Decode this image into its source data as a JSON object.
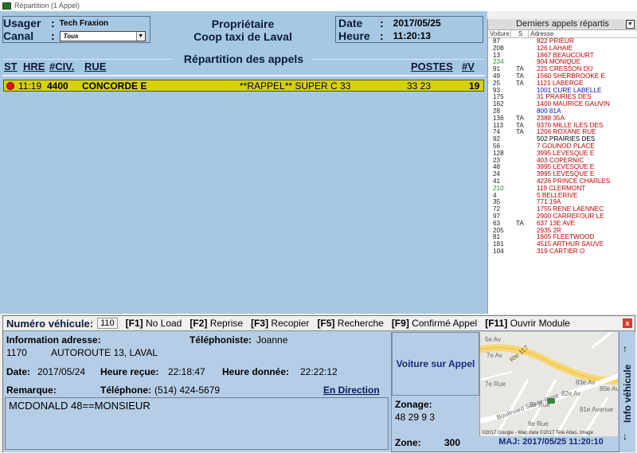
{
  "window": {
    "title": "Répartition (1 Appel)"
  },
  "header": {
    "usager_label": "Usager",
    "usager_value": "Tech Fraxion",
    "canal_label": "Canal",
    "canal_value": "Tous",
    "owner_line1": "Propriétaire",
    "owner_line2": "Coop taxi de Laval",
    "date_label": "Date",
    "date_value": "2017/05/25",
    "heure_label": "Heure",
    "heure_value": "11:20:13"
  },
  "dispatch": {
    "title": "Répartition des appels",
    "columns": {
      "st": "ST",
      "hre": "HRE",
      "civ": "#CIV.",
      "rue": "RUE",
      "postes": "POSTES",
      "v": "#V"
    },
    "call": {
      "time": "11:19",
      "civ": "4400",
      "street": "CONCORDE E",
      "note": "**RAPPEL** SUPER C 33",
      "postes": "33 23",
      "v": "19",
      "status_color": "#e41010"
    }
  },
  "recent": {
    "title": "Derniers appels répartis",
    "headers": {
      "voiture": "Voiture",
      "s": "S",
      "adresse": "Adresse"
    },
    "rows": [
      {
        "v": "87",
        "s": "",
        "a": "822 PRIEUR",
        "c": "#c00000"
      },
      {
        "v": "208",
        "s": "",
        "a": "126 LAHAIE",
        "c": "#c00000"
      },
      {
        "v": "13",
        "s": "",
        "a": "1867 BEAUCOURT",
        "c": "#c00000"
      },
      {
        "v": "234",
        "s": "",
        "a": "904 MONIQUE",
        "c": "#c00000",
        "vc": "#1a9a1a"
      },
      {
        "v": "91",
        "s": "TA",
        "a": "225 CRESSON DU",
        "c": "#c00000"
      },
      {
        "v": "49",
        "s": "TA",
        "a": "1560 SHERBROOKE E",
        "c": "#c00000"
      },
      {
        "v": "25",
        "s": "TA",
        "a": "1121 LABERGE",
        "c": "#c00000"
      },
      {
        "v": "93",
        "s": "",
        "a": "1001 CURE LABELLE",
        "c": "#1010d0"
      },
      {
        "v": "175",
        "s": "",
        "a": "31 PRAIRIES DES",
        "c": "#c00000"
      },
      {
        "v": "162",
        "s": "",
        "a": "1400 MAURICE GAUVIN",
        "c": "#c00000"
      },
      {
        "v": "28",
        "s": "",
        "a": "800 81A",
        "c": "#1010d0"
      },
      {
        "v": "136",
        "s": "TA",
        "a": "2388 35A",
        "c": "#c00000"
      },
      {
        "v": "113",
        "s": "TA",
        "a": "9370 MILLE ILES DES",
        "c": "#c00000"
      },
      {
        "v": "74",
        "s": "TA",
        "a": "1206 ROXANE RUE",
        "c": "#c00000"
      },
      {
        "v": "92",
        "s": "",
        "a": "502 PRAIRIES DES",
        "c": "#000000"
      },
      {
        "v": "56",
        "s": "",
        "a": "7 GOUNOD PLACE",
        "c": "#c00000"
      },
      {
        "v": "128",
        "s": "",
        "a": "3995 LEVESQUE E",
        "c": "#c00000"
      },
      {
        "v": "23",
        "s": "",
        "a": "403 COPERNIC",
        "c": "#c00000"
      },
      {
        "v": "48",
        "s": "",
        "a": "3995 LEVESQUE E",
        "c": "#c00000"
      },
      {
        "v": "24",
        "s": "",
        "a": "3995 LEVESQUE E",
        "c": "#c00000"
      },
      {
        "v": "41",
        "s": "",
        "a": "4226 PRINCE CHARLES",
        "c": "#c00000"
      },
      {
        "v": "210",
        "s": "",
        "a": "119 CLERMONT",
        "c": "#c00000",
        "vc": "#1a9a1a"
      },
      {
        "v": "4",
        "s": "",
        "a": "5 BELLERIVE",
        "c": "#c00000"
      },
      {
        "v": "35",
        "s": "",
        "a": "771 19A",
        "c": "#c00000"
      },
      {
        "v": "72",
        "s": "",
        "a": "1755 RENE LAENNEC",
        "c": "#c00000"
      },
      {
        "v": "97",
        "s": "",
        "a": "2900 CARREFOUR LE",
        "c": "#c00000"
      },
      {
        "v": "63",
        "s": "TA",
        "a": "637 13E AVE",
        "c": "#c00000"
      },
      {
        "v": "205",
        "s": "",
        "a": "2935 2R",
        "c": "#c00000"
      },
      {
        "v": "81",
        "s": "",
        "a": "1605 FLEETWOOD",
        "c": "#c00000"
      },
      {
        "v": "181",
        "s": "",
        "a": "4515 ARTHUR SAUVE",
        "c": "#c00000"
      },
      {
        "v": "104",
        "s": "",
        "a": "319 CARTIER O",
        "c": "#c00000"
      }
    ]
  },
  "bottom": {
    "vehicle_label": "Numéro véhicule:",
    "vehicle_value": "110",
    "fkeys": [
      {
        "key": "[F1]",
        "label": "No Load"
      },
      {
        "key": "[F2]",
        "label": "Reprise"
      },
      {
        "key": "[F3]",
        "label": "Recopier"
      },
      {
        "key": "[F5]",
        "label": "Recherche"
      },
      {
        "key": "[F9]",
        "label": "Confirmé Appel"
      },
      {
        "key": "[F11]",
        "label": "Ouvrir Module"
      }
    ],
    "close_icon": "x",
    "info_address_label": "Information adresse:",
    "telephoniste_label": "Téléphoniste:",
    "telephoniste_value": "Joanne",
    "address_num": "1170",
    "address_street": "AUTOROUTE 13, LAVAL",
    "date_label": "Date:",
    "date_value": "2017/05/24",
    "heure_recue_label": "Heure reçue:",
    "heure_recue_value": "22:18:47",
    "heure_donnee_label": "Heure donnée:",
    "heure_donnee_value": "22:22:12",
    "remarque_label": "Remarque:",
    "telephone_label": "Téléphone:",
    "telephone_value": "(514) 424-5679",
    "en_direction": "En Direction",
    "remark_text": "MCDONALD 48==MONSIEUR",
    "voiture_sur_appel": "Voiture sur Appel",
    "zonage_label": "Zonage:",
    "zonage_value": "48  29  9  3",
    "zone_label": "Zone:",
    "zone_value": "300",
    "map_credit": "©2017 Google - Map data ©2017 Tele Atlas, Image",
    "map_labels": [
      "Rte 117",
      "Boulevard Sainte-Rose",
      "7e Rue",
      "8e Rue",
      "9e Rue",
      "80e Av",
      "81e Avenue",
      "82e Av",
      "83e Av",
      "5e Av",
      "7e Av"
    ],
    "maj": "MAJ: 2017/05/25 11:20:10",
    "info_vehicule": "Info véhicule",
    "arrow_up": "↑",
    "arrow_down": "↓"
  }
}
